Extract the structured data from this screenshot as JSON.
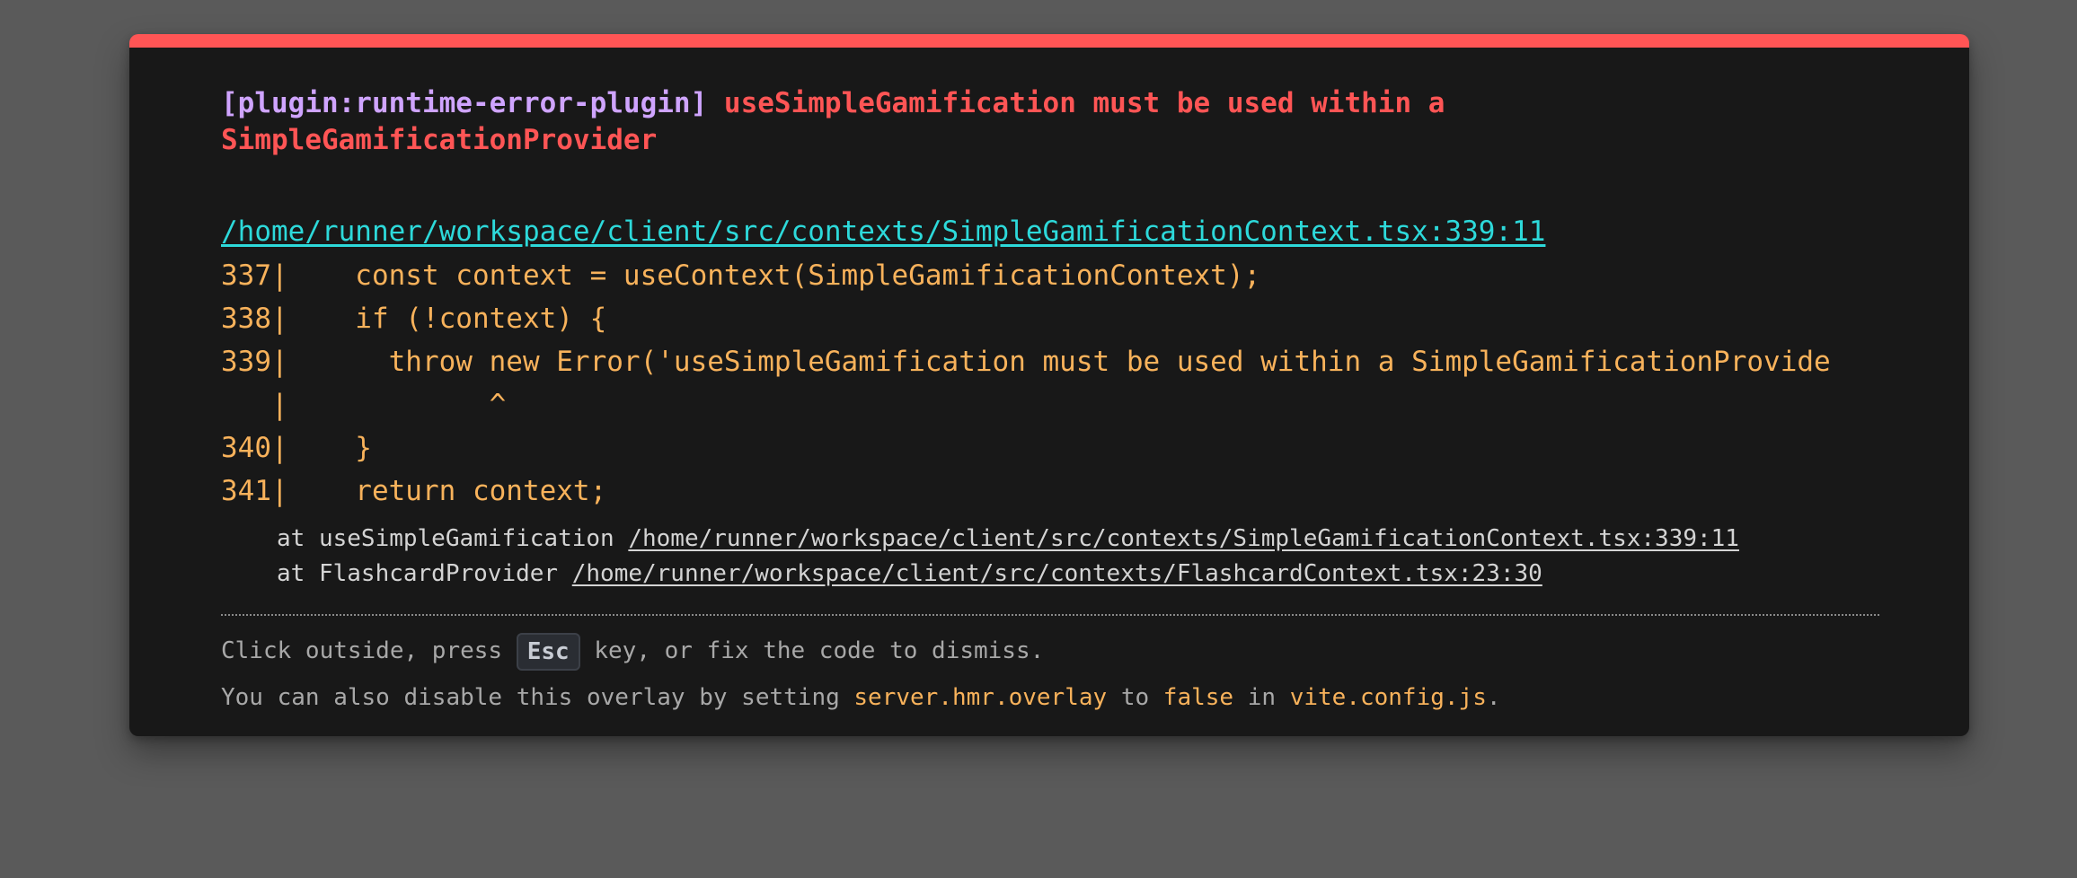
{
  "error": {
    "plugin_tag": "[plugin:runtime-error-plugin]",
    "message": "useSimpleGamification must be used within a SimpleGamificationProvider",
    "file": "/home/runner/workspace/client/src/contexts/SimpleGamificationContext.tsx:339:11"
  },
  "frame": [
    "337|    const context = useContext(SimpleGamificationContext);",
    "338|    if (!context) {",
    "339|      throw new Error('useSimpleGamification must be used within a SimpleGamificationProvide",
    "   |            ^",
    "340|    }",
    "341|    return context;"
  ],
  "stack": [
    {
      "prefix": "at useSimpleGamification ",
      "link": "/home/runner/workspace/client/src/contexts/SimpleGamificationContext.tsx:339:11"
    },
    {
      "prefix": "at FlashcardProvider ",
      "link": "/home/runner/workspace/client/src/contexts/FlashcardContext.tsx:23:30"
    }
  ],
  "tip": {
    "line1_before": "Click outside, press ",
    "esc_key": "Esc",
    "line1_after": " key, or fix the code to dismiss.",
    "line2_part1": "You can also disable this overlay by setting ",
    "line2_code1": "server.hmr.overlay",
    "line2_part2": " to ",
    "line2_code2": "false",
    "line2_part3": " in ",
    "line2_code3": "vite.config.js",
    "line2_part4": "."
  },
  "colors": {
    "backdrop": "#5a5a5a",
    "window_bg": "#181818",
    "accent_red": "#ff5555",
    "plugin_purple": "#cfa4ff",
    "file_cyan": "#2dd9da",
    "code_yellow": "#f8b25b",
    "muted_text": "#a8a8a8"
  }
}
